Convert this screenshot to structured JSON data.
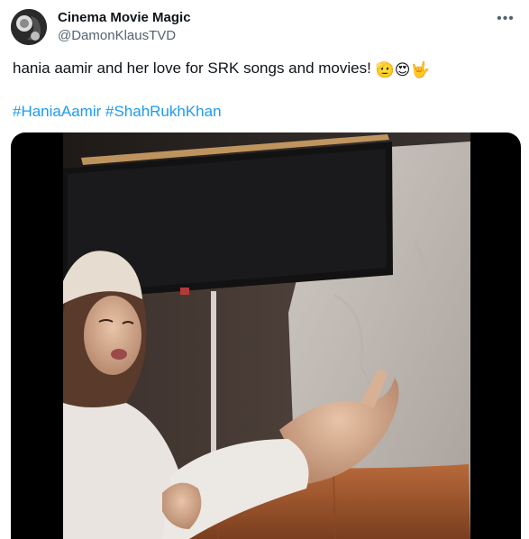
{
  "tweet": {
    "display_name": "Cinema Movie Magic",
    "handle": "@DamonKlausTVD",
    "more_icon": "more-dots-icon",
    "text": "hania aamir and her love for SRK songs and movies!",
    "emojis": [
      "🫡",
      "😍",
      "🤟"
    ],
    "hashtags": [
      "#HaniaAamir",
      "#ShahRukhKhan"
    ],
    "media_type": "video",
    "colors": {
      "link": "#1d9bf0",
      "secondary": "#536471",
      "primary_text": "#0f1419"
    }
  }
}
